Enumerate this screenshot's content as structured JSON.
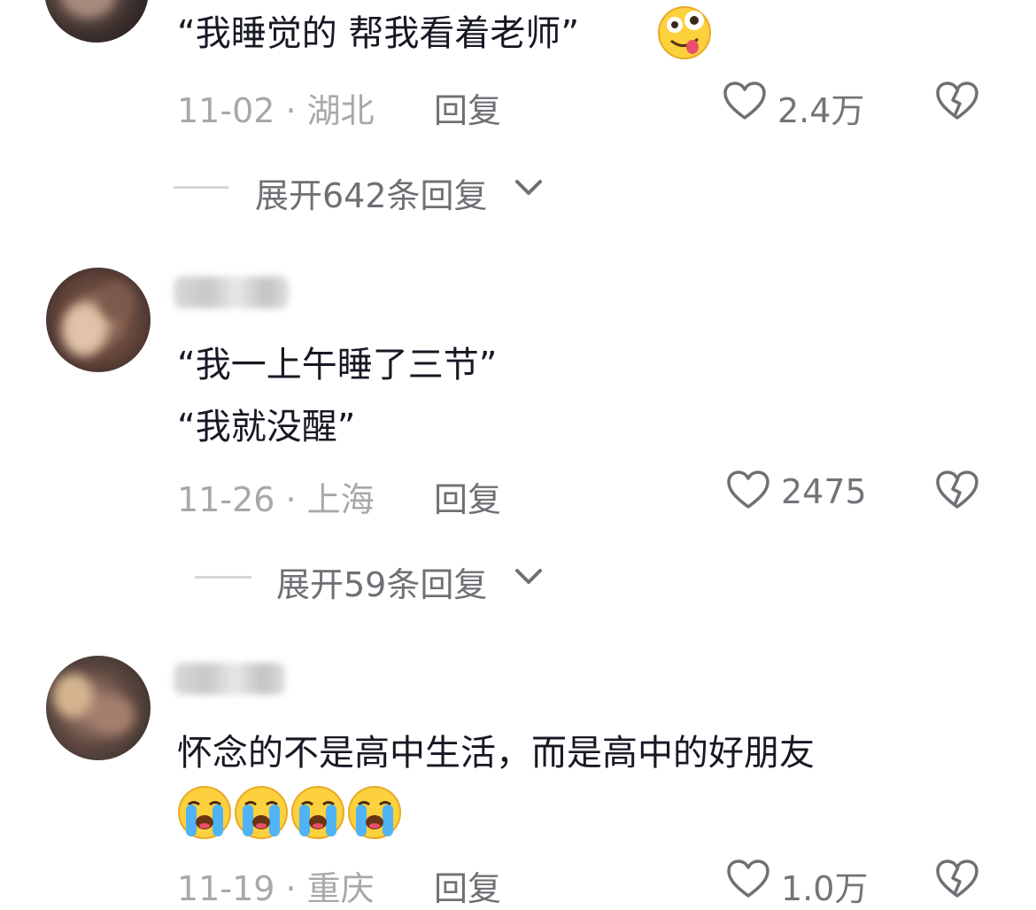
{
  "comments": [
    {
      "text_lines": [
        "“我睡觉的 帮我看着老师”"
      ],
      "date": "11-02",
      "location": "湖北",
      "reply_label": "回复",
      "likes": "2.4万",
      "expand_label": "展开642条回复"
    },
    {
      "text_lines": [
        "“我一上午睡了三节”",
        "“我就没醒”"
      ],
      "date": "11-26",
      "location": "上海",
      "reply_label": "回复",
      "likes": "2475",
      "expand_label": "展开59条回复"
    },
    {
      "text_lines": [
        "怀念的不是高中生活，而是高中的好朋友"
      ],
      "date": "11-19",
      "location": "重庆",
      "reply_label": "回复",
      "likes": "1.0万"
    }
  ],
  "separator": " · ",
  "icons": {
    "like": "heart-outline-icon",
    "dislike": "broken-heart-icon",
    "expand": "chevron-down-icon",
    "emoji_tongue": "crazy-face-emoji",
    "emoji_cry": "loudly-crying-emoji"
  },
  "colors": {
    "text": "#161823",
    "meta": "#a7a8ac",
    "secondary": "#6f7075"
  }
}
